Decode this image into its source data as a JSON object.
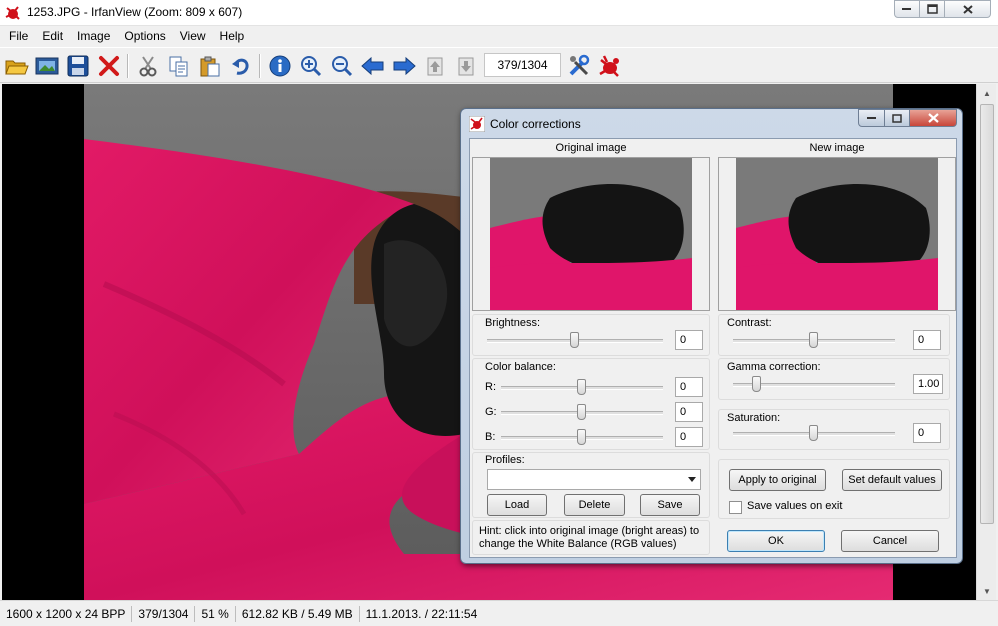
{
  "window": {
    "title": "1253.JPG - IrfanView (Zoom: 809 x 607)"
  },
  "menu": [
    "File",
    "Edit",
    "Image",
    "Options",
    "View",
    "Help"
  ],
  "toolbar": {
    "icons": [
      "open-folder-icon",
      "slideshow-icon",
      "save-icon",
      "delete-icon",
      "cut-icon",
      "copy-icon",
      "paste-icon",
      "undo-icon",
      "info-icon",
      "zoom-in-icon",
      "zoom-out-icon",
      "previous-icon",
      "next-icon",
      "first-file-icon",
      "last-file-icon",
      "settings-icon",
      "irfanview-icon"
    ],
    "counter": "379/1304"
  },
  "dialog": {
    "title": "Color corrections",
    "original_label": "Original image",
    "new_label": "New image",
    "brightness": {
      "label": "Brightness:",
      "value": "0",
      "position": 0.5
    },
    "contrast": {
      "label": "Contrast:",
      "value": "0",
      "position": 0.5
    },
    "color_balance": {
      "label": "Color balance:",
      "channels": [
        {
          "label": "R:",
          "value": "0",
          "position": 0.5
        },
        {
          "label": "G:",
          "value": "0",
          "position": 0.5
        },
        {
          "label": "B:",
          "value": "0",
          "position": 0.5
        }
      ]
    },
    "gamma": {
      "label": "Gamma correction:",
      "value": "1.00",
      "position": 0.15
    },
    "saturation": {
      "label": "Saturation:",
      "value": "0",
      "position": 0.5
    },
    "profiles": {
      "label": "Profiles:",
      "selected": "",
      "load": "Load",
      "delete": "Delete",
      "save": "Save"
    },
    "apply_to_original": "Apply to original",
    "set_default_values": "Set default values",
    "save_values_on_exit": {
      "label": "Save values on exit",
      "checked": false
    },
    "hint": "Hint: click into original image (bright areas) to change the White Balance (RGB values)",
    "ok": "OK",
    "cancel": "Cancel"
  },
  "status": {
    "dimensions": "1600 x 1200 x 24 BPP",
    "index": "379/1304",
    "zoom": "51 %",
    "size": "612.82 KB / 5.49 MB",
    "datetime": "11.1.2013. / 22:11:54"
  },
  "colors": {
    "accent_pink": "#e8125e",
    "dialog_frame": "#c7d5e7",
    "close_red": "#c8463a"
  }
}
